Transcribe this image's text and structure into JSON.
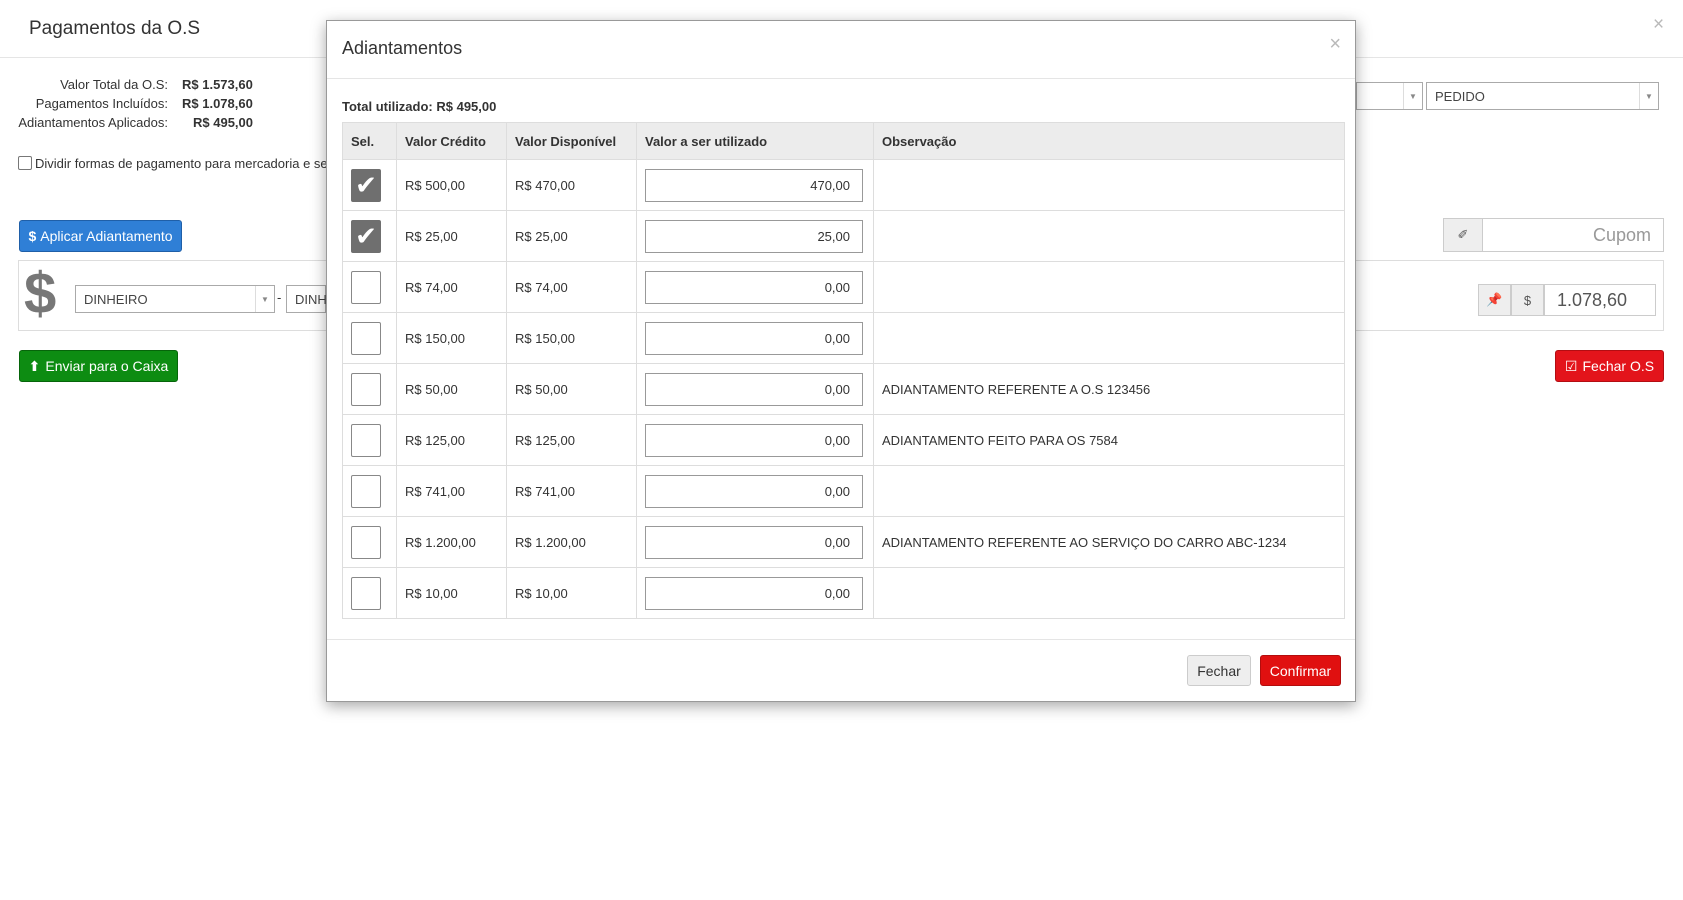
{
  "page": {
    "title": "Pagamentos da O.S",
    "close": "×"
  },
  "summary": [
    {
      "label": "Valor Total da O.S:",
      "value": "R$ 1.573,60"
    },
    {
      "label": "Pagamentos Incluídos:",
      "value": "R$ 1.078,60"
    },
    {
      "label": "Adiantamentos Aplicados:",
      "value": "R$ 495,00"
    }
  ],
  "split_checkbox_label": "Dividir formas de pagamento para mercadoria e se",
  "buttons": {
    "aplicar": "Aplicar Adiantamento",
    "enviar": "Enviar para o Caixa",
    "fechar_os": "Fechar O.S"
  },
  "payment": {
    "method": "DINHEIRO",
    "method2": "DINH",
    "dash": "-",
    "amount": "1.078,60",
    "currency_addon": "$",
    "order_type": "PEDIDO",
    "coupon_placeholder": "Cupom"
  },
  "modal": {
    "title": "Adiantamentos",
    "close": "×",
    "total_label": "Total utilizado: R$ 495,00",
    "headers": [
      "Sel.",
      "Valor Crédito",
      "Valor Disponível",
      "Valor a ser utilizado",
      "Observação"
    ],
    "rows": [
      {
        "selected": true,
        "credito": "R$ 500,00",
        "disponivel": "R$ 470,00",
        "utilizar": "470,00",
        "obs": ""
      },
      {
        "selected": true,
        "credito": "R$ 25,00",
        "disponivel": "R$ 25,00",
        "utilizar": "25,00",
        "obs": ""
      },
      {
        "selected": false,
        "credito": "R$ 74,00",
        "disponivel": "R$ 74,00",
        "utilizar": "0,00",
        "obs": ""
      },
      {
        "selected": false,
        "credito": "R$ 150,00",
        "disponivel": "R$ 150,00",
        "utilizar": "0,00",
        "obs": ""
      },
      {
        "selected": false,
        "credito": "R$ 50,00",
        "disponivel": "R$ 50,00",
        "utilizar": "0,00",
        "obs": "ADIANTAMENTO REFERENTE A O.S 123456"
      },
      {
        "selected": false,
        "credito": "R$ 125,00",
        "disponivel": "R$ 125,00",
        "utilizar": "0,00",
        "obs": "ADIANTAMENTO FEITO PARA OS 7584"
      },
      {
        "selected": false,
        "credito": "R$ 741,00",
        "disponivel": "R$ 741,00",
        "utilizar": "0,00",
        "obs": ""
      },
      {
        "selected": false,
        "credito": "R$ 1.200,00",
        "disponivel": "R$ 1.200,00",
        "utilizar": "0,00",
        "obs": "ADIANTAMENTO REFERENTE AO SERVIÇO DO CARRO ABC-1234"
      },
      {
        "selected": false,
        "credito": "R$ 10,00",
        "disponivel": "R$ 10,00",
        "utilizar": "0,00",
        "obs": ""
      }
    ],
    "btn_fechar": "Fechar",
    "btn_confirmar": "Confirmar"
  },
  "colors": {
    "primary": "#2f7fd6",
    "success": "#0d8c12",
    "danger": "#e3141b",
    "checked": "#6f6f6f"
  }
}
